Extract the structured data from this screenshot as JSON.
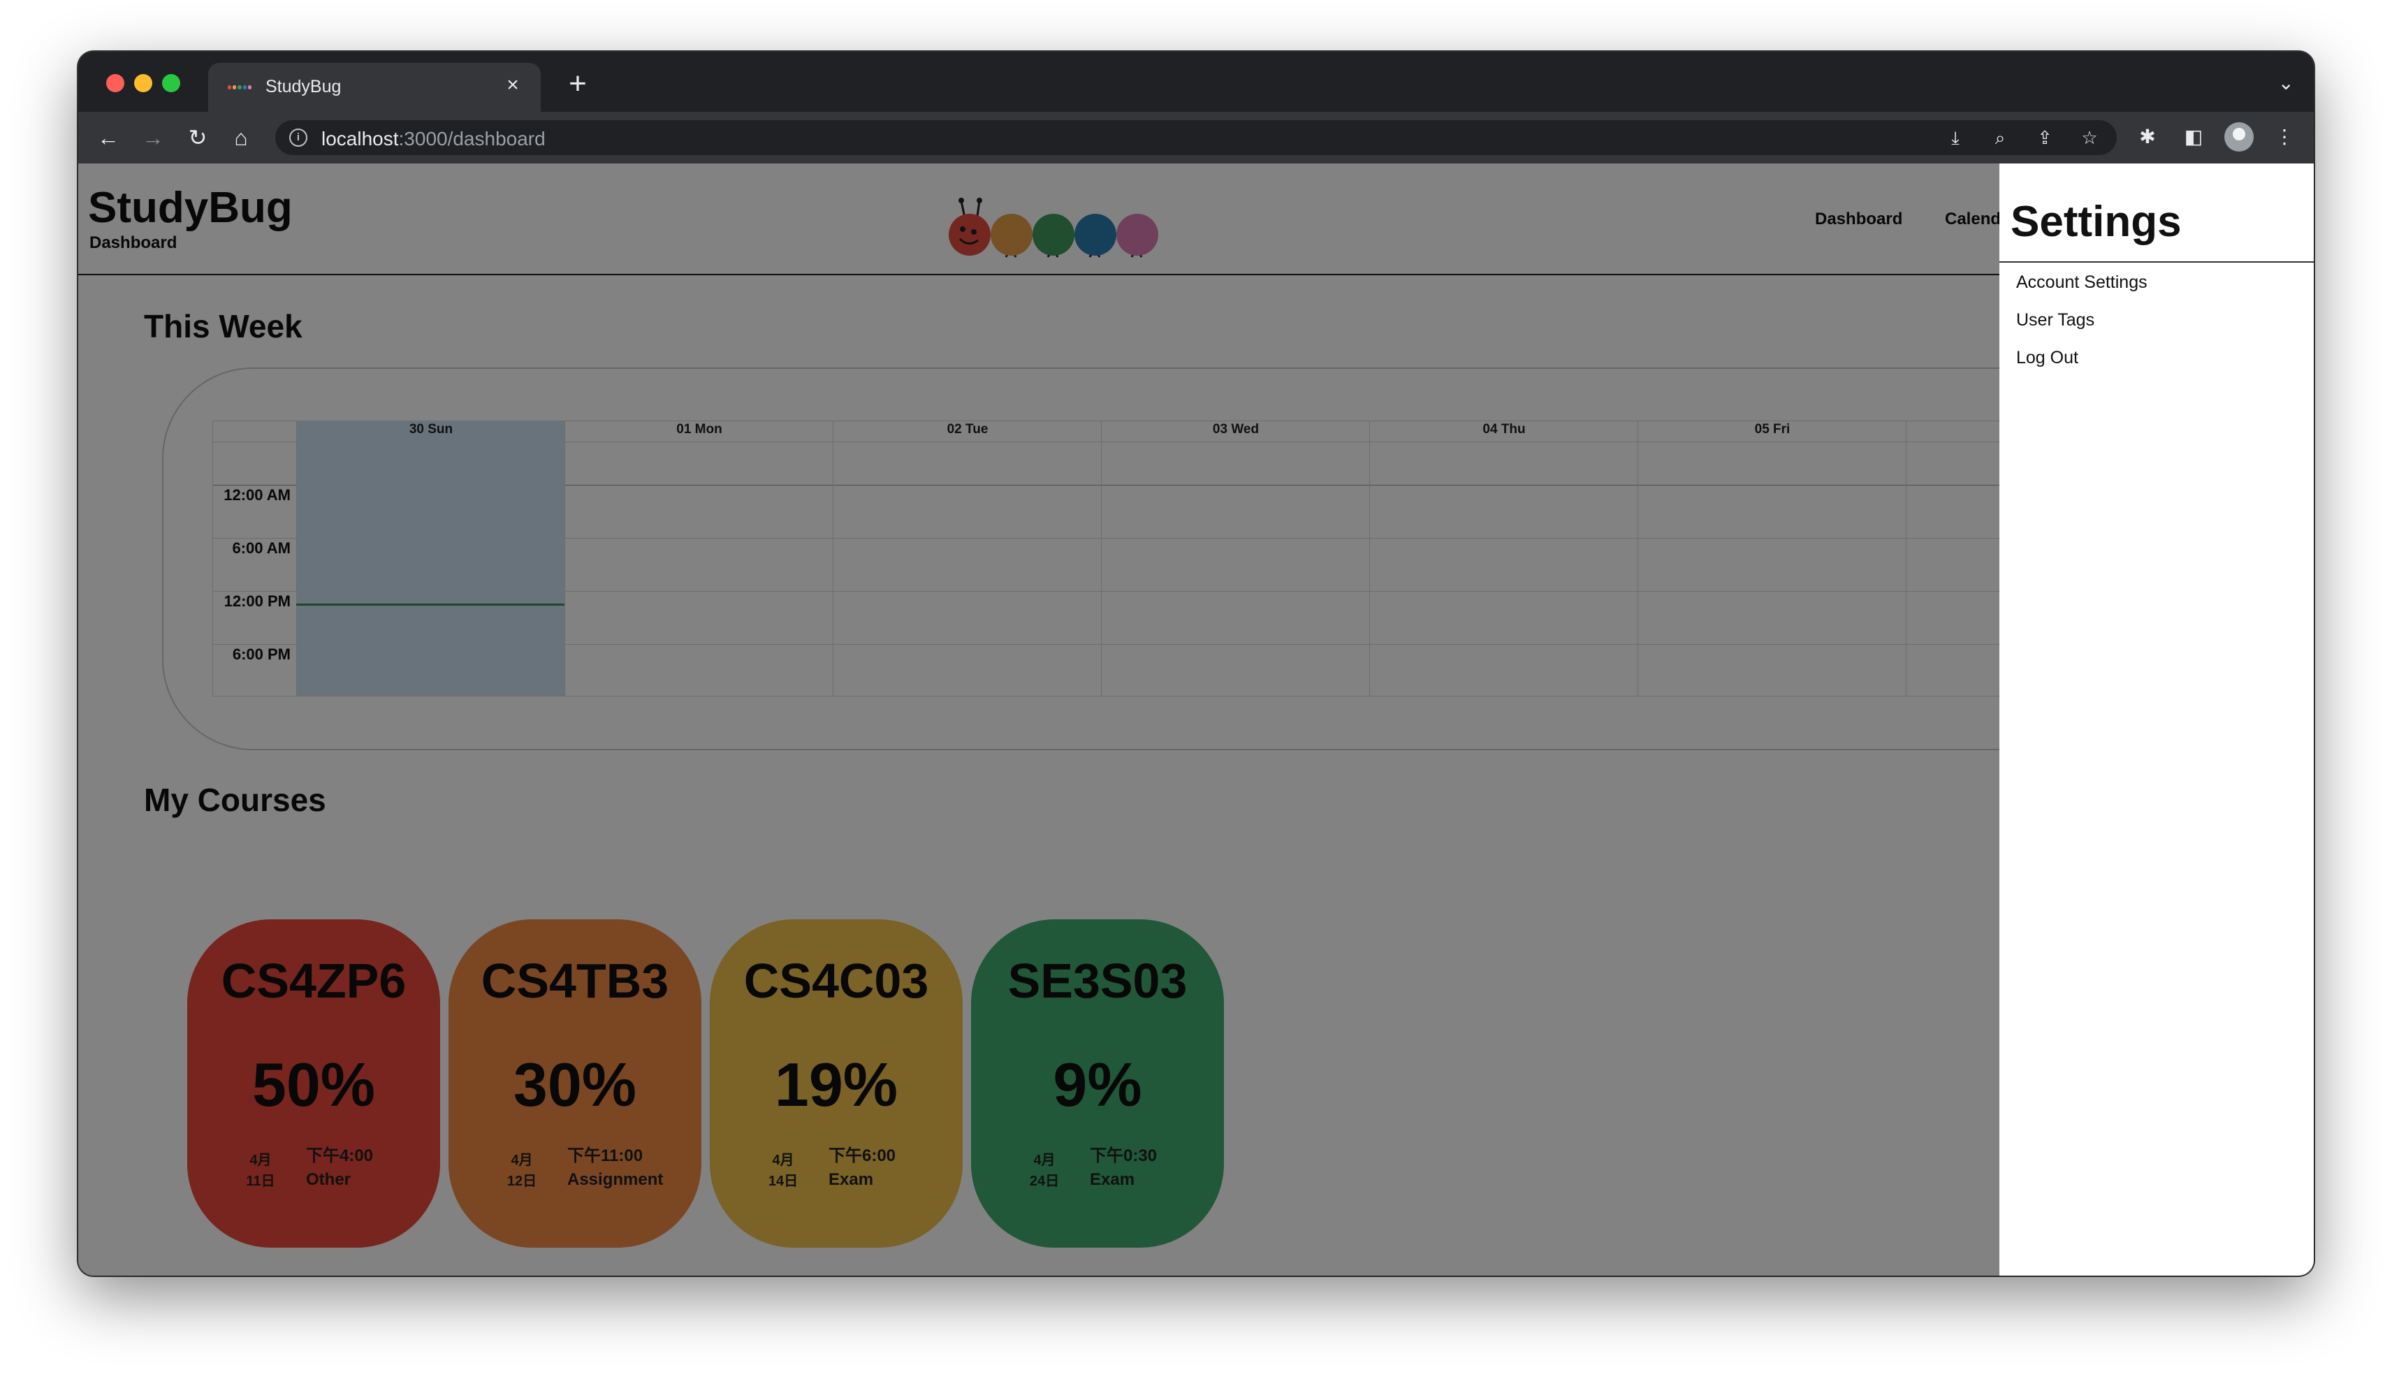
{
  "browser": {
    "tab_title": "StudyBug",
    "tab_close_glyph": "×",
    "new_tab_glyph": "+",
    "url_host": "localhost",
    "url_path": ":3000/dashboard"
  },
  "app": {
    "title": "StudyBug",
    "subtitle": "Dashboard",
    "nav": [
      "Dashboard",
      "Calend"
    ]
  },
  "logo_colors": [
    "#e44d41",
    "#e89f4a",
    "#3f9a5d",
    "#2c7fb0",
    "#dc7cb5"
  ],
  "this_week": {
    "title": "This Week",
    "days": [
      "30 Sun",
      "01 Mon",
      "02 Tue",
      "03 Wed",
      "04 Thu",
      "05 Fri"
    ],
    "today_index": 0,
    "times": [
      "12:00 AM",
      "6:00 AM",
      "12:00 PM",
      "6:00 PM"
    ]
  },
  "courses": {
    "title": "My Courses",
    "items": [
      {
        "code": "CS4ZP6",
        "percent": "50%",
        "month": "4月",
        "day": "11日",
        "time": "下午4:00",
        "type": "Other",
        "color": "#e94a3c"
      },
      {
        "code": "CS4TB3",
        "percent": "30%",
        "month": "4月",
        "day": "12日",
        "time": "下午11:00",
        "type": "Assignment",
        "color": "#f18b45"
      },
      {
        "code": "CS4C03",
        "percent": "19%",
        "month": "4月",
        "day": "14日",
        "time": "下午6:00",
        "type": "Exam",
        "color": "#f2c24e"
      },
      {
        "code": "SE3S03",
        "percent": "9%",
        "month": "4月",
        "day": "24日",
        "time": "下午0:30",
        "type": "Exam",
        "color": "#3fad70"
      }
    ]
  },
  "settings": {
    "title": "Settings",
    "items": [
      "Account Settings",
      "User Tags",
      "Log Out"
    ]
  },
  "icons": [
    "back-arrow-icon",
    "forward-arrow-icon",
    "reload-icon",
    "home-icon",
    "info-icon",
    "install-icon",
    "zoom-icon",
    "share-icon",
    "bookmark-star-icon",
    "extensions-icon",
    "side-panel-icon",
    "profile-avatar-icon",
    "menu-dots-icon",
    "tab-list-chevron-icon"
  ]
}
